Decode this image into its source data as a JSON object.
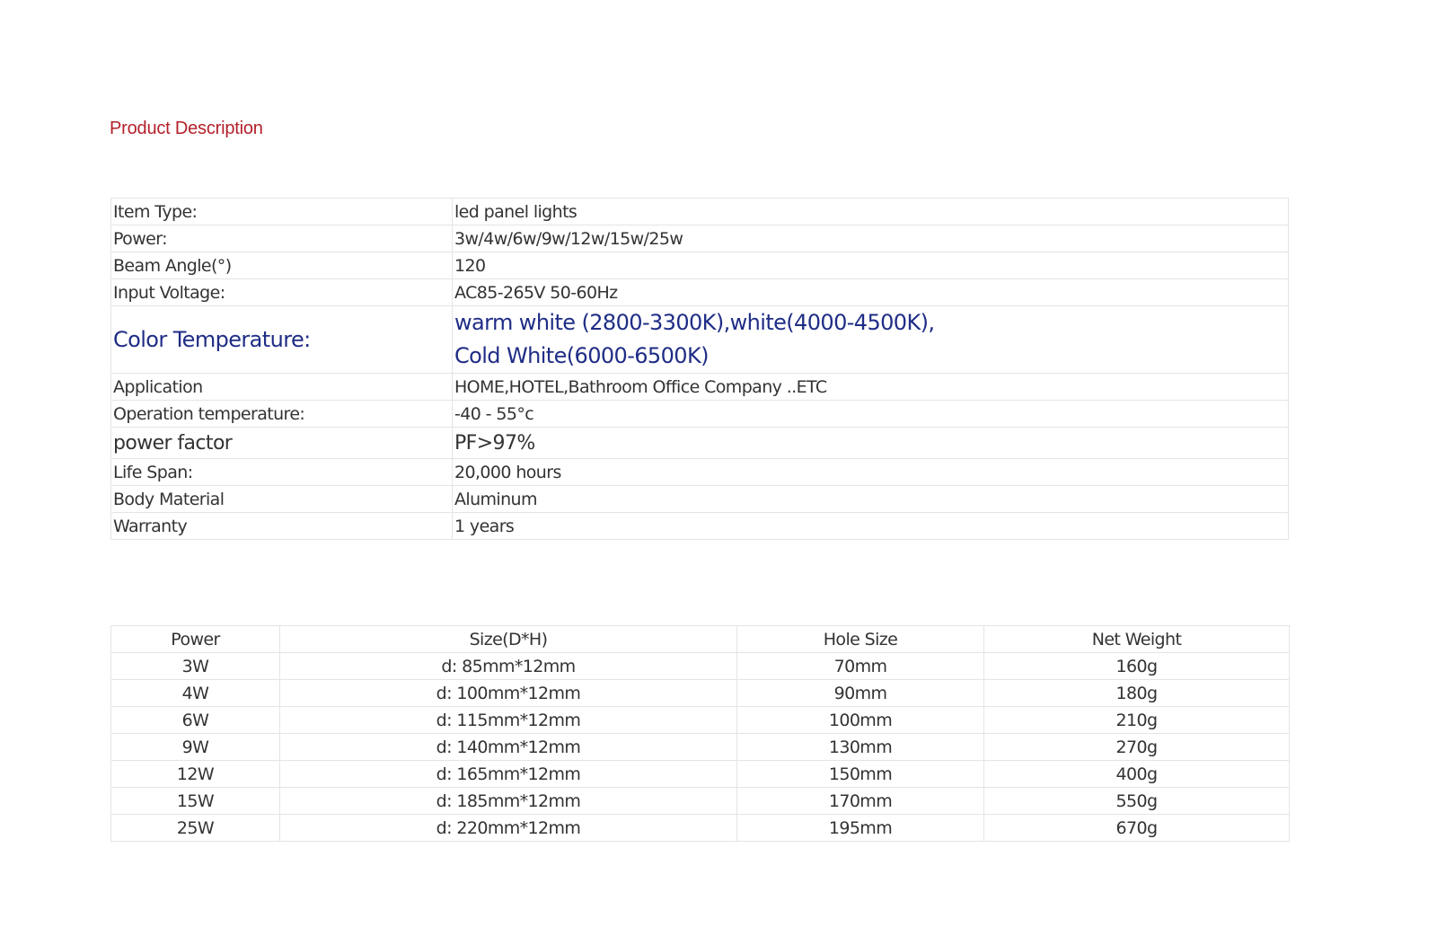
{
  "title": "Product Description",
  "colors": {
    "title": "#b3202a",
    "highlight": "#1f2d86",
    "text": "#333333",
    "border": "#e4e4e4"
  },
  "specs": [
    {
      "label": "Item Type:",
      "value": "led panel lights"
    },
    {
      "label": "Power:",
      "value": "3w/4w/6w/9w/12w/15w/25w"
    },
    {
      "label": "Beam Angle(°)",
      "value": "120"
    },
    {
      "label": "Input Voltage:",
      "value": "AC85-265V  50-60Hz"
    },
    {
      "label": "Color Temperature:",
      "value_lines": [
        "warm white (2800-3300K),white(4000-4500K),",
        "Cold White(6000-6500K)"
      ]
    },
    {
      "label": "Application",
      "value": "HOME,HOTEL,Bathroom Office  Company ..ETC"
    },
    {
      "label": "Operation temperature:",
      "value": "-40 - 55°c"
    },
    {
      "label": "power factor",
      "value": "PF>97%"
    },
    {
      "label": "Life Span:",
      "value": "20,000 hours"
    },
    {
      "label": "Body Material",
      "value": "Aluminum"
    },
    {
      "label": "Warranty",
      "value": "1 years"
    }
  ],
  "size_table": {
    "headers": [
      "Power",
      "Size(D*H)",
      "Hole Size",
      "Net Weight"
    ],
    "rows": [
      [
        "3W",
        "d: 85mm*12mm",
        "70mm",
        "160g"
      ],
      [
        "4W",
        "d: 100mm*12mm",
        "90mm",
        "180g"
      ],
      [
        "6W",
        "d: 115mm*12mm",
        "100mm",
        "210g"
      ],
      [
        "9W",
        "d: 140mm*12mm",
        "130mm",
        "270g"
      ],
      [
        "12W",
        "d: 165mm*12mm",
        "150mm",
        "400g"
      ],
      [
        "15W",
        "d: 185mm*12mm",
        "170mm",
        "550g"
      ],
      [
        "25W",
        "d: 220mm*12mm",
        "195mm",
        "670g"
      ]
    ]
  }
}
